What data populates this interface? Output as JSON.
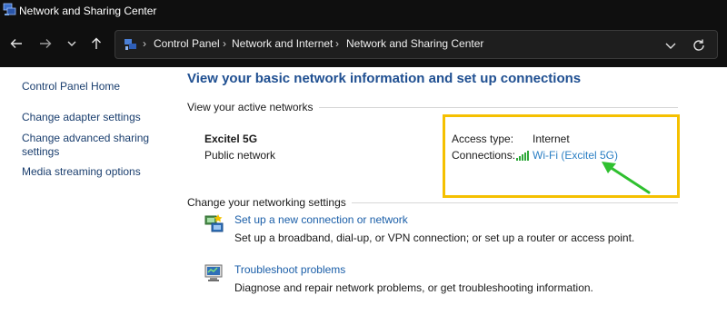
{
  "window": {
    "title": "Network and Sharing Center",
    "icon": "network-sharing-center-icon"
  },
  "nav": {
    "back_icon": "arrow-left-icon",
    "forward_icon": "arrow-right-icon",
    "recent_icon": "chevron-down-icon",
    "up_icon": "arrow-up-icon"
  },
  "address_bar": {
    "icon": "control-panel-icon",
    "breadcrumbs": [
      "Control Panel",
      "Network and Internet",
      "Network and Sharing Center"
    ],
    "dropdown_icon": "chevron-down-icon",
    "refresh_icon": "refresh-icon"
  },
  "sidebar": {
    "items": [
      {
        "label": "Control Panel Home"
      },
      {
        "label": "Change adapter settings"
      },
      {
        "label": "Change advanced sharing settings"
      },
      {
        "label": "Media streaming options"
      }
    ]
  },
  "main": {
    "heading": "View your basic network information and set up connections",
    "active_networks_label": "View your active networks",
    "network": {
      "name": "Excitel 5G",
      "category": "Public network",
      "access_type_label": "Access type:",
      "access_type_value": "Internet",
      "connections_label": "Connections:",
      "connection_value": "Wi-Fi (Excitel 5G)",
      "connection_icon": "wifi-signal-icon"
    },
    "change_settings_label": "Change your networking settings",
    "tasks": [
      {
        "icon": "new-connection-icon",
        "title": "Set up a new connection or network",
        "description": "Set up a broadband, dial-up, or VPN connection; or set up a router or access point."
      },
      {
        "icon": "troubleshoot-icon",
        "title": "Troubleshoot problems",
        "description": "Diagnose and repair network problems, or get troubleshooting information."
      }
    ]
  },
  "annotations": {
    "highlight_color": "#f5c000",
    "arrow_color": "#2fc02f"
  },
  "colors": {
    "title_bar": "#0f0f0f",
    "heading": "#1f4f91",
    "link": "#1a5ea8"
  }
}
